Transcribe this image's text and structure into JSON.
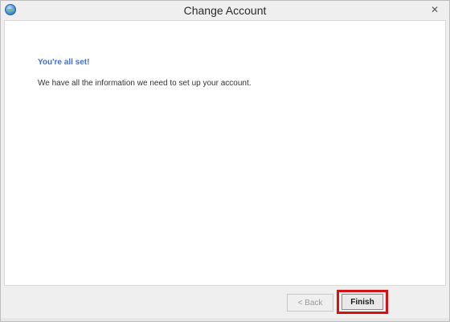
{
  "window": {
    "title": "Change Account"
  },
  "content": {
    "heading": "You're all set!",
    "message": "We have all the information we need to set up your account."
  },
  "footer": {
    "back_label": "< Back",
    "finish_label": "Finish"
  },
  "icons": {
    "app_icon": "outlook-globe-icon",
    "close_icon": "close-icon"
  },
  "colors": {
    "heading": "#3a6fd8",
    "highlight": "#d31313"
  }
}
